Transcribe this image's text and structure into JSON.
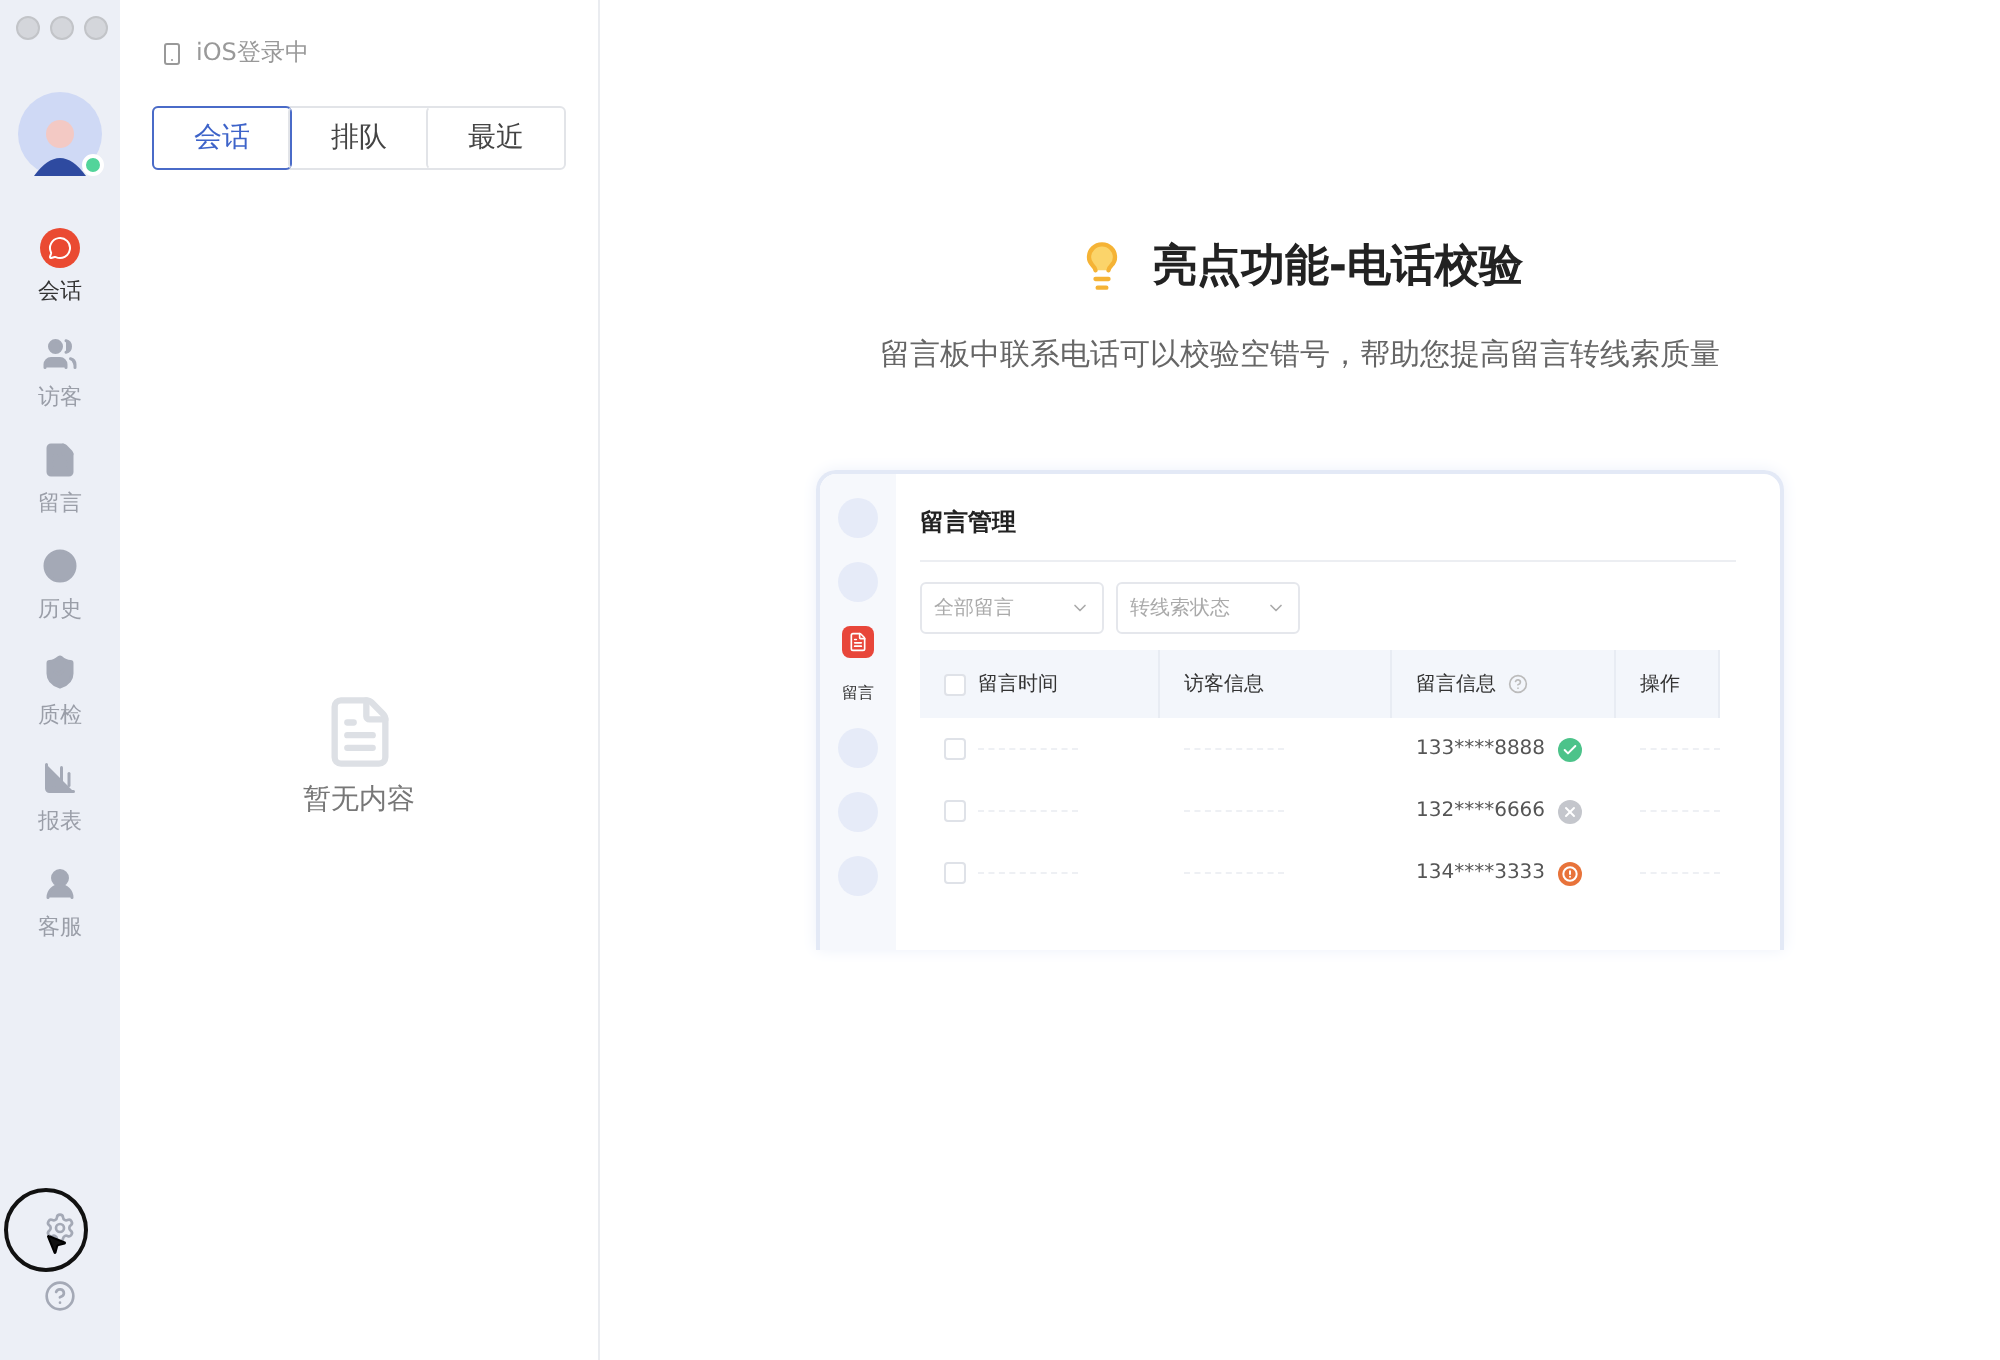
{
  "sidebar": {
    "avatar": {
      "online": true
    },
    "items": [
      {
        "label": "会话",
        "selected": true
      },
      {
        "label": "访客",
        "selected": false
      },
      {
        "label": "留言",
        "selected": false
      },
      {
        "label": "历史",
        "selected": false
      },
      {
        "label": "质检",
        "selected": false
      },
      {
        "label": "报表",
        "selected": false
      },
      {
        "label": "客服",
        "selected": false
      }
    ]
  },
  "panel": {
    "login_status": "iOS登录中",
    "tabs": [
      {
        "label": "会话",
        "selected": true
      },
      {
        "label": "排队",
        "selected": false
      },
      {
        "label": "最近",
        "selected": false
      }
    ],
    "empty_text": "暂无内容"
  },
  "feature": {
    "title": "亮点功能-电话校验",
    "subtitle": "留言板中联系电话可以校验空错号，帮助您提高留言转线索质量",
    "preview": {
      "nav_label": "留言",
      "heading": "留言管理",
      "filters": [
        "全部留言",
        "转线索状态"
      ],
      "columns": [
        "留言时间",
        "访客信息",
        "留言信息",
        "操作"
      ],
      "select_all_checked": false,
      "rows": [
        {
          "phone": "133****8888",
          "kind": "valid",
          "checked": false
        },
        {
          "phone": "132****6666",
          "kind": "invalid",
          "checked": false
        },
        {
          "phone": "134****3333",
          "kind": "warning",
          "checked": false
        }
      ]
    }
  }
}
